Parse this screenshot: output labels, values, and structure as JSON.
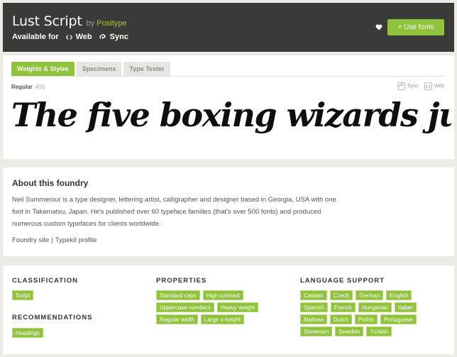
{
  "header": {
    "title": "Lust Script",
    "by_label": "by",
    "foundry": "Positype",
    "available_label": "Available for",
    "web_label": "Web",
    "sync_label": "Sync",
    "use_fonts_label": "+ Use fonts"
  },
  "tabs": [
    {
      "label": "Weights & Styles",
      "active": true
    },
    {
      "label": "Specimens",
      "active": false
    },
    {
      "label": "Type Tester",
      "active": false
    }
  ],
  "style": {
    "name": "Regular",
    "weight": "400",
    "sync_label": "Sync",
    "web_label": "Web",
    "sample_text": "The five boxing wizards jump quickly"
  },
  "about": {
    "title": "About this foundry",
    "text": "Neil Summerour is a type designer, lettering artist, calligrapher and designer based in Georgia, USA with one foot in Takamatsu, Japan. He's published over 60 typeface families (that's over 500 fonts) and produced numerous custom typefaces for clients worldwide.",
    "foundry_site_label": "Foundry site",
    "separator": "|",
    "typekit_profile_label": "Typekit profile"
  },
  "classification": {
    "title": "CLASSIFICATION",
    "tags": [
      "Script"
    ]
  },
  "recommendations": {
    "title": "RECOMMENDATIONS",
    "tags": [
      "Headings"
    ]
  },
  "properties": {
    "title": "PROPERTIES",
    "tags": [
      "Standard caps",
      "High contrast",
      "Uppercase numbers",
      "Heavy weight",
      "Regular width",
      "Large x-height"
    ]
  },
  "language_support": {
    "title": "LANGUAGE SUPPORT",
    "tags": [
      "Catalan",
      "Czech",
      "German",
      "English",
      "Spanish",
      "French",
      "Hungarian",
      "Italian",
      "Maltese",
      "Dutch",
      "Polish",
      "Portuguese",
      "Slovenian",
      "Swedish",
      "Turkish"
    ]
  },
  "colors": {
    "accent": "#8fc33c",
    "header_bg": "#3a3a38",
    "page_bg": "#ecebe6"
  }
}
